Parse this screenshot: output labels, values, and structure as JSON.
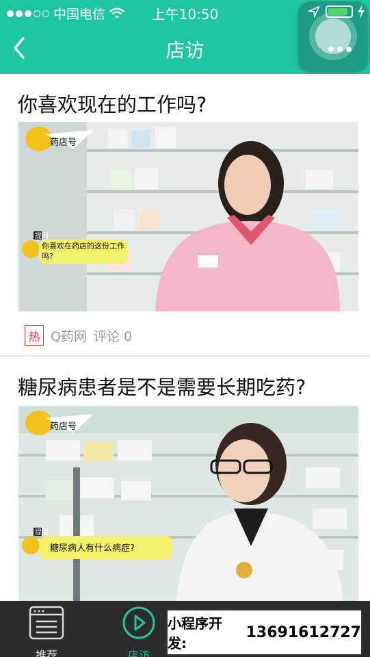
{
  "status_bar": {
    "carrier": "中国电信",
    "time": "上午10:50"
  },
  "nav": {
    "title": "店访"
  },
  "articles": [
    {
      "title": "你喜欢现在的工作吗?",
      "logo_text": "药店号",
      "question_tag": "提问",
      "question_bubble": "你喜欢在药店的这份工作吗?",
      "hot_badge": "热",
      "source": "Q药网",
      "comments": "评论 0"
    },
    {
      "title": "糖尿病患者是不是需要长期吃药?",
      "logo_text": "药店号",
      "question_tag": "提问",
      "question_bubble": "糖尿病人有什么病症?"
    }
  ],
  "tabbar": {
    "recommend_label": "推荐",
    "store_label": "店访"
  },
  "promo": {
    "label": "小程序开发:",
    "phone": "13691612727"
  },
  "colors": {
    "brand": "#1fc6a6",
    "hot": "#e23b3b",
    "tabbar_bg": "#2b2b2b"
  }
}
